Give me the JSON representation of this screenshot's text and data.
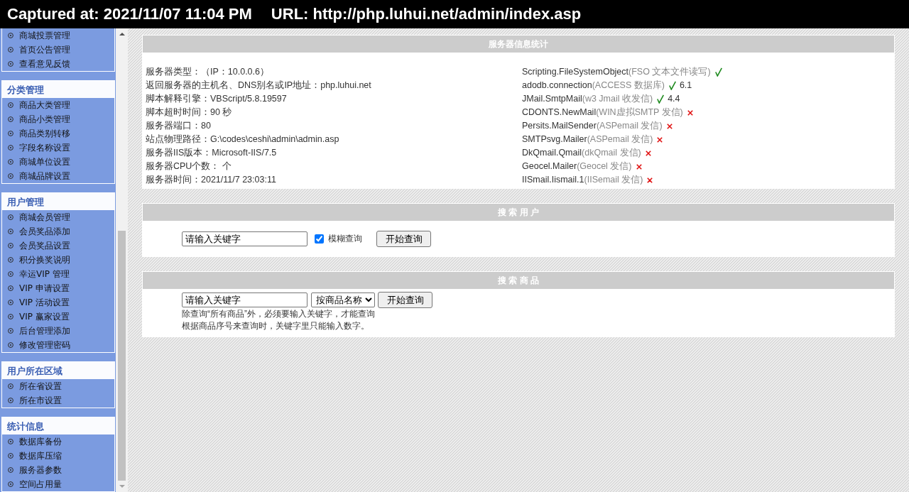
{
  "banner": {
    "captured_at": "Captured at: 2021/11/07 11:04 PM",
    "url": "URL: http://php.luhui.net/admin/index.asp"
  },
  "sidebar": {
    "groups": [
      {
        "items": [
          "商城投票管理",
          "首页公告管理",
          "查看意见反馈"
        ]
      },
      {
        "title": "分类管理",
        "items": [
          "商品大类管理",
          "商品小类管理",
          "商品类别转移",
          "字段名称设置",
          "商城单位设置",
          "商城品牌设置"
        ]
      },
      {
        "title": "用户管理",
        "items": [
          "商城会员管理",
          "会员奖品添加",
          "会员奖品设置",
          "积分换奖说明",
          "幸运VIP 管理",
          "VIP 申请设置",
          "VIP 活动设置",
          "VIP 赢家设置",
          "后台管理添加",
          "修改管理密码"
        ]
      },
      {
        "title": "用户所在区域",
        "items": [
          "所在省设置",
          "所在市设置"
        ]
      },
      {
        "title": "统计信息",
        "items": [
          "数据库备份",
          "数据库压缩",
          "服务器参数",
          "空间占用量"
        ]
      }
    ]
  },
  "server_info": {
    "title": "服务器信息统计",
    "properties": [
      "服务器类型：（IP：10.0.0.6）",
      "返回服务器的主机名、DNS别名或IP地址：php.luhui.net",
      "脚本解释引擎：VBScript/5.8.19597",
      "脚本超时时间：90 秒",
      "服务器端口：80",
      "站点物理路径：G:\\codes\\ceshi\\admin\\admin.asp",
      "服务器IIS版本：Microsoft-IIS/7.5",
      "服务器CPU个数： 个",
      "服务器时间：2021/11/7 23:03:11"
    ],
    "components": [
      {
        "name": "Scripting.FileSystemObject",
        "description": "(FSO 文本文件读写)",
        "installed": true
      },
      {
        "name": "adodb.connection",
        "description": "(ACCESS 数据库)",
        "installed": true,
        "version": "6.1"
      },
      {
        "name": "JMail.SmtpMail",
        "description": "(w3 Jmail 收发信)",
        "installed": true,
        "version": "4.4"
      },
      {
        "name": "CDONTS.NewMail",
        "description": "(WIN虚拟SMTP 发信)",
        "installed": false
      },
      {
        "name": "Persits.MailSender",
        "description": "(ASPemail 发信)",
        "installed": false
      },
      {
        "name": "SMTPsvg.Mailer",
        "description": "(ASPemail 发信)",
        "installed": false
      },
      {
        "name": "DkQmail.Qmail",
        "description": "(dkQmail 发信)",
        "installed": false
      },
      {
        "name": "Geocel.Mailer",
        "description": "(Geocel 发信)",
        "installed": false
      },
      {
        "name": "IISmail.Iismail.1",
        "description": "(IISemail 发信)",
        "installed": false
      }
    ]
  },
  "search_user": {
    "title": "搜 索 用 户",
    "keyword": {
      "value": "请输入关键字"
    },
    "fuzzy": {
      "label": "模糊查询",
      "checked": true
    },
    "button": "开始查询"
  },
  "search_product": {
    "title": "搜 索 商 品",
    "keyword": {
      "value": "请输入关键字"
    },
    "field": {
      "value": "按商品名称"
    },
    "button": "开始查询",
    "notes": [
      "除查询“所有商品”外，必须要输入关键字，才能查询",
      "根据商品序号来查询时，关键字里只能输入数字。"
    ]
  }
}
